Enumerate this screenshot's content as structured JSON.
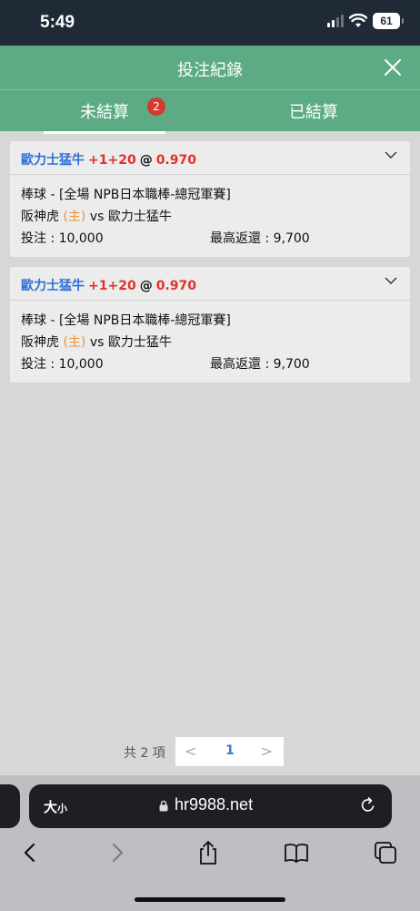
{
  "status": {
    "time": "5:49",
    "battery": "61"
  },
  "header": {
    "title": "投注紀錄"
  },
  "tabs": {
    "pending": {
      "label": "未結算",
      "badge": "2"
    },
    "settled": {
      "label": "已結算"
    }
  },
  "bets": [
    {
      "team": "歐力士猛牛",
      "handicap": "+1+20",
      "at": "@",
      "odds": "0.970",
      "league": "棒球 - [全場 NPB日本職棒-總冠軍賽]",
      "home_team": "阪神虎",
      "home_tag": "(主)",
      "vs": "vs",
      "away_team": "歐力士猛牛",
      "stake": "投注 : 10,000",
      "max_return": "最高返還 : 9,700"
    },
    {
      "team": "歐力士猛牛",
      "handicap": "+1+20",
      "at": "@",
      "odds": "0.970",
      "league": "棒球 - [全場 NPB日本職棒-總冠軍賽]",
      "home_team": "阪神虎",
      "home_tag": "(主)",
      "vs": "vs",
      "away_team": "歐力士猛牛",
      "stake": "投注 : 10,000",
      "max_return": "最高返還 : 9,700"
    }
  ],
  "pager": {
    "total": "共 2 項",
    "prev": "<",
    "current": "1",
    "next": ">"
  },
  "browser": {
    "text_size_big": "大",
    "text_size_small": "小",
    "url": "hr9988.net"
  },
  "icons": {
    "close": "close-icon",
    "chevron": "chevron-down-icon",
    "lock": "lock-icon",
    "reload": "reload-icon",
    "back": "back-icon",
    "forward": "forward-icon",
    "share": "share-icon",
    "bookmarks": "bookmarks-icon",
    "tabs": "tabs-icon"
  },
  "colors": {
    "header_green": "#5dab84",
    "team_blue": "#2f6fd6",
    "odds_red": "#e0322d",
    "home_orange": "#e8943a",
    "badge_red": "#d23b2f",
    "page_num_blue": "#3a7bd5"
  }
}
